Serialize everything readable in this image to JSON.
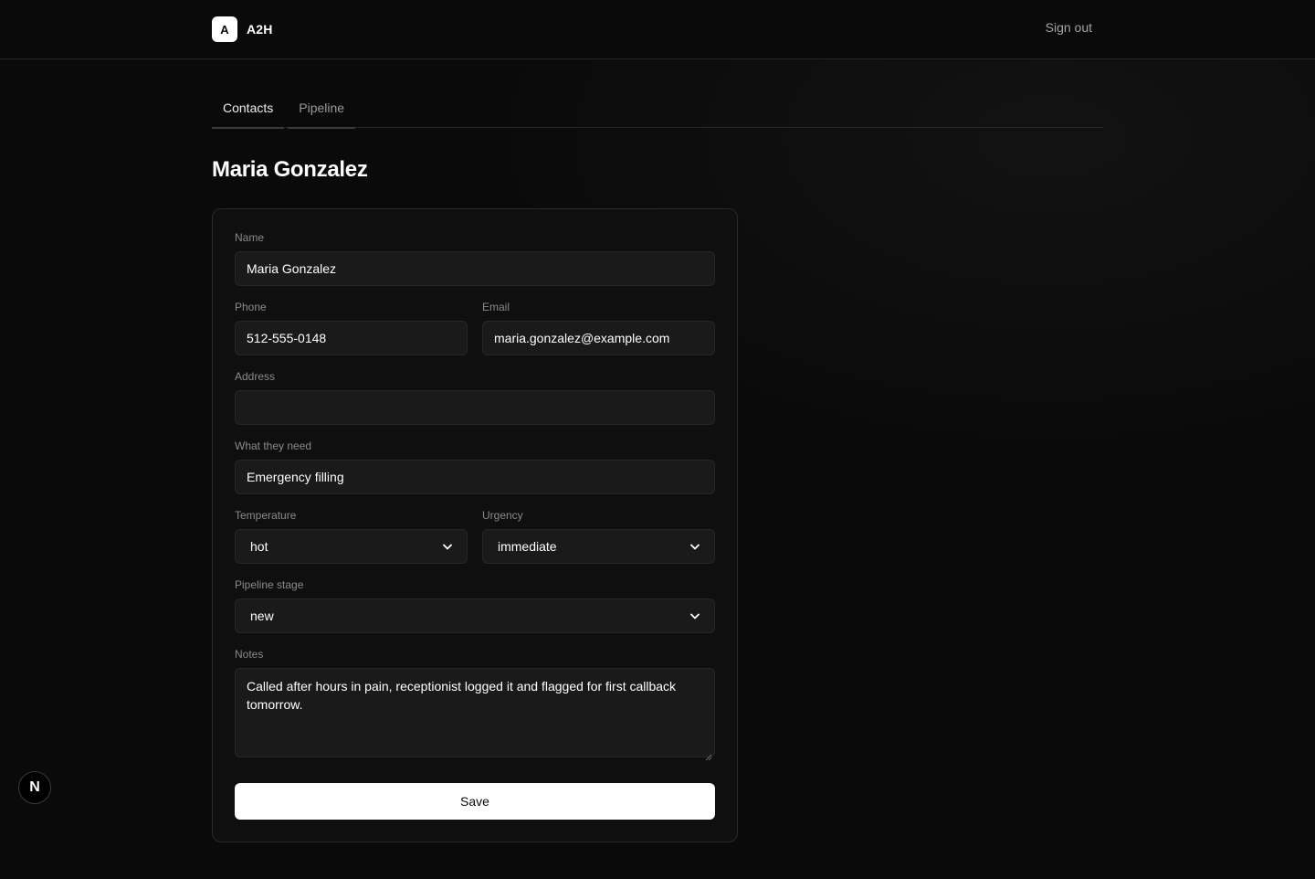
{
  "header": {
    "logo_letter": "A",
    "brand": "A2H",
    "sign_out": "Sign out"
  },
  "tabs": [
    {
      "label": "Contacts",
      "active": true
    },
    {
      "label": "Pipeline",
      "active": false
    }
  ],
  "page_title": "Maria Gonzalez",
  "form": {
    "name": {
      "label": "Name",
      "value": "Maria Gonzalez"
    },
    "phone": {
      "label": "Phone",
      "value": "512-555-0148"
    },
    "email": {
      "label": "Email",
      "value": "maria.gonzalez@example.com"
    },
    "address": {
      "label": "Address",
      "value": ""
    },
    "need": {
      "label": "What they need",
      "value": "Emergency filling"
    },
    "temperature": {
      "label": "Temperature",
      "value": "hot"
    },
    "urgency": {
      "label": "Urgency",
      "value": "immediate"
    },
    "stage": {
      "label": "Pipeline stage",
      "value": "new"
    },
    "notes": {
      "label": "Notes",
      "value": "Called after hours in pain, receptionist logged it and flagged for first callback tomorrow."
    },
    "save_label": "Save"
  },
  "dev_badge": {
    "letter": "N",
    "icon": "nextjs-icon"
  },
  "colors": {
    "background": "#0a0a0a",
    "card": "#0f0f0f",
    "input": "#1a1a1a",
    "button": "#ffffff"
  }
}
